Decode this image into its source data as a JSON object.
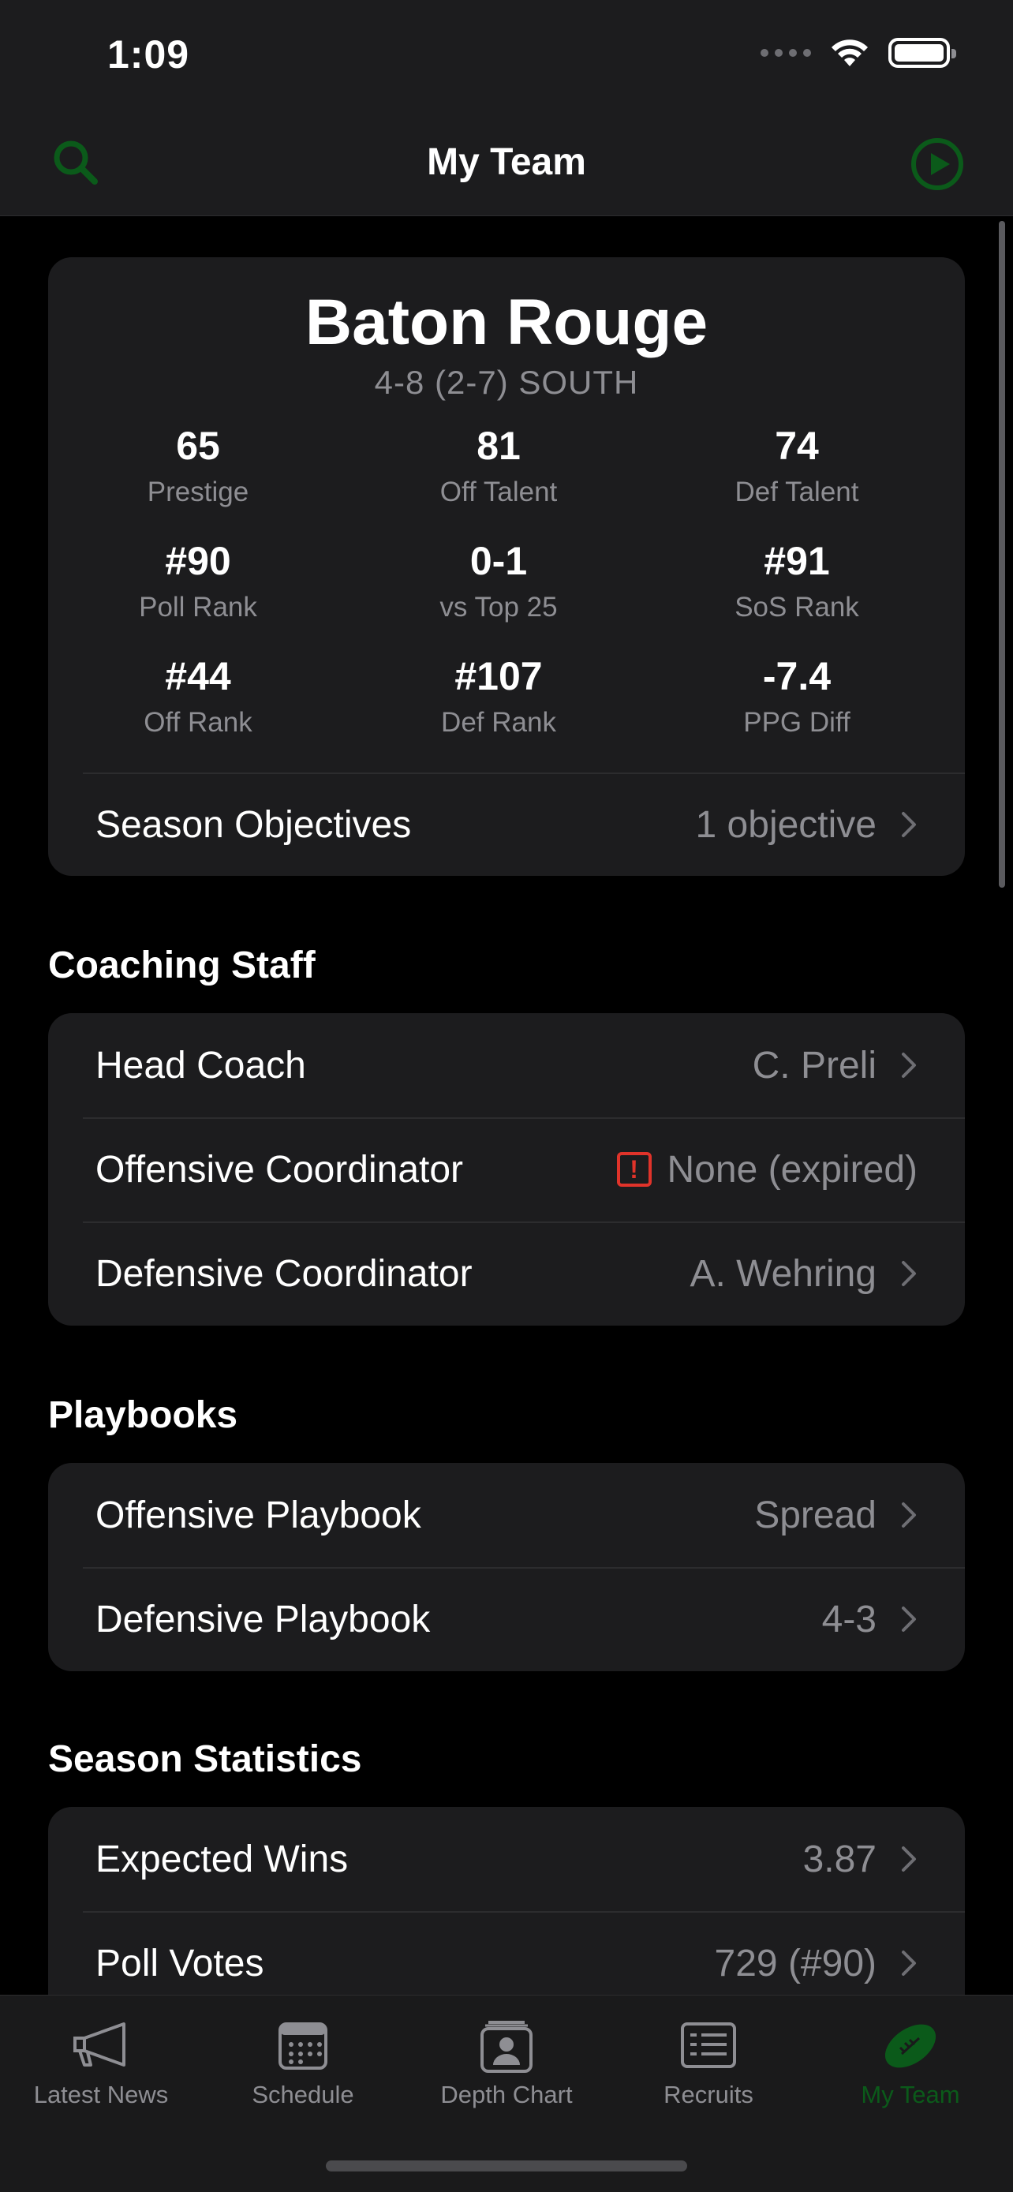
{
  "status_bar": {
    "time": "1:09"
  },
  "nav": {
    "title": "My Team",
    "left_icon": "search-icon",
    "right_icon": "play-circle-icon",
    "icon_color": "#0b5a1a"
  },
  "team": {
    "name": "Baton Rouge",
    "record": "4-8 (2-7) SOUTH",
    "stats": [
      {
        "value": "65",
        "label": "Prestige"
      },
      {
        "value": "81",
        "label": "Off Talent"
      },
      {
        "value": "74",
        "label": "Def Talent"
      },
      {
        "value": "#90",
        "label": "Poll Rank"
      },
      {
        "value": "0-1",
        "label": "vs Top 25"
      },
      {
        "value": "#91",
        "label": "SoS Rank"
      },
      {
        "value": "#44",
        "label": "Off Rank"
      },
      {
        "value": "#107",
        "label": "Def Rank"
      },
      {
        "value": "-7.4",
        "label": "PPG Diff"
      }
    ],
    "objectives": {
      "label": "Season Objectives",
      "value": "1 objective"
    }
  },
  "coaching_staff": {
    "title": "Coaching Staff",
    "rows": [
      {
        "label": "Head Coach",
        "value": "C. Preli"
      },
      {
        "label": "Offensive Coordinator",
        "value": "None (expired)",
        "warning": "!"
      },
      {
        "label": "Defensive Coordinator",
        "value": "A. Wehring"
      }
    ]
  },
  "playbooks": {
    "title": "Playbooks",
    "rows": [
      {
        "label": "Offensive Playbook",
        "value": "Spread"
      },
      {
        "label": "Defensive Playbook",
        "value": "4-3"
      }
    ]
  },
  "season_statistics": {
    "title": "Season Statistics",
    "rows": [
      {
        "label": "Expected Wins",
        "value": "3.87"
      },
      {
        "label": "Poll Votes",
        "value": "729 (#90)"
      }
    ]
  },
  "tab_bar": {
    "tabs": [
      {
        "label": "Latest News",
        "icon": "megaphone-icon"
      },
      {
        "label": "Schedule",
        "icon": "calendar-icon"
      },
      {
        "label": "Depth Chart",
        "icon": "person-card-icon"
      },
      {
        "label": "Recruits",
        "icon": "list-card-icon"
      },
      {
        "label": "My Team",
        "icon": "football-icon",
        "active": true
      }
    ],
    "active_color": "#0b5a1a"
  }
}
